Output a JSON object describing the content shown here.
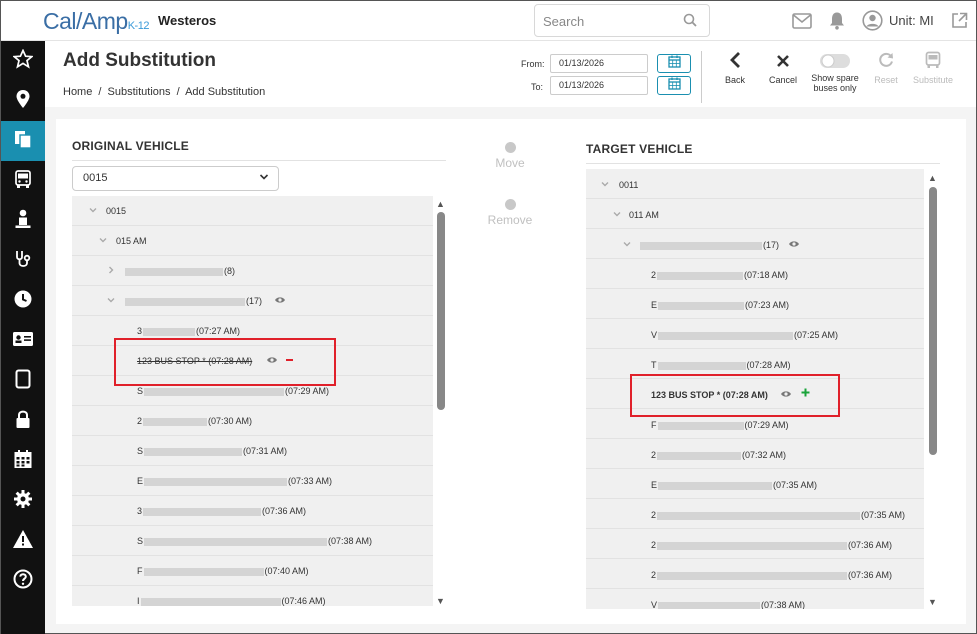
{
  "app": {
    "logo_text": "Cal/Amp",
    "logo_sub": "K-12",
    "district": "Westeros",
    "search_placeholder": "Search",
    "unit_label": "Unit: MI"
  },
  "page": {
    "title": "Add Substitution",
    "breadcrumb": [
      "Home",
      "/",
      "Substitutions",
      "/",
      "Add Substitution"
    ],
    "from_label": "From:",
    "from_value": "01/13/2026",
    "to_label": "To:",
    "to_value": "01/13/2026"
  },
  "toolbar": {
    "back": "Back",
    "cancel": "Cancel",
    "spare_line1": "Show spare",
    "spare_line2": "buses only",
    "reset": "Reset",
    "substitute": "Substitute"
  },
  "sidebar_icons": [
    "star-icon",
    "map-pin-icon",
    "documents-icon",
    "bus-icon",
    "student-icon",
    "stethoscope-icon",
    "clock-icon",
    "id-card-icon",
    "tablet-icon",
    "lock-icon",
    "calendar-icon",
    "gear-icon",
    "warning-icon",
    "help-icon"
  ],
  "actions": {
    "move": "Move",
    "remove": "Remove"
  },
  "original": {
    "title": "ORIGINAL VEHICLE",
    "selected": "0015",
    "rows": [
      {
        "pre": "",
        "text": "0015",
        "post": ""
      },
      {
        "pre": "",
        "text": "015 AM",
        "post": ""
      },
      {
        "pre": "",
        "text": "",
        "post": "(8)"
      },
      {
        "pre": "",
        "text": "",
        "post": "(17)"
      },
      {
        "pre": "3",
        "text": "",
        "post": "(07:27 AM)"
      },
      {
        "pre": "",
        "text": "123 BUS STOP * (07:28 AM)",
        "post": ""
      },
      {
        "pre": "S",
        "text": "",
        "post": "(07:29 AM)"
      },
      {
        "pre": "2",
        "text": "",
        "post": "(07:30 AM)"
      },
      {
        "pre": "S",
        "text": "",
        "post": "(07:31 AM)"
      },
      {
        "pre": "E",
        "text": "",
        "post": "(07:33 AM)"
      },
      {
        "pre": "3",
        "text": "",
        "post": "(07:36 AM)"
      },
      {
        "pre": "S",
        "text": "",
        "post": "(07:38 AM)"
      },
      {
        "pre": "F",
        "text": "",
        "post": "(07:40 AM)"
      },
      {
        "pre": "I",
        "text": "",
        "post": "(07:46 AM)"
      }
    ]
  },
  "target": {
    "title": "TARGET VEHICLE",
    "rows": [
      {
        "pre": "",
        "text": "0011",
        "post": ""
      },
      {
        "pre": "",
        "text": "011 AM",
        "post": ""
      },
      {
        "pre": "",
        "text": "",
        "post": "(17)"
      },
      {
        "pre": "2",
        "text": "",
        "post": "(07:18 AM)"
      },
      {
        "pre": "E",
        "text": "",
        "post": "(07:23 AM)"
      },
      {
        "pre": "V",
        "text": "",
        "post": "(07:25 AM)"
      },
      {
        "pre": "T",
        "text": "",
        "post": "(07:28 AM)"
      },
      {
        "pre": "",
        "text": "123 BUS STOP * (07:28 AM)",
        "post": ""
      },
      {
        "pre": "F",
        "text": "",
        "post": "(07:29 AM)"
      },
      {
        "pre": "2",
        "text": "",
        "post": "(07:32 AM)"
      },
      {
        "pre": "E",
        "text": "",
        "post": "(07:35 AM)"
      },
      {
        "pre": "2",
        "text": "",
        "post": "(07:35 AM)"
      },
      {
        "pre": "2",
        "text": "",
        "post": "(07:36 AM)"
      },
      {
        "pre": "2",
        "text": "",
        "post": "(07:36 AM)"
      },
      {
        "pre": "V",
        "text": "",
        "post": "(07:38 AM)"
      }
    ]
  }
}
